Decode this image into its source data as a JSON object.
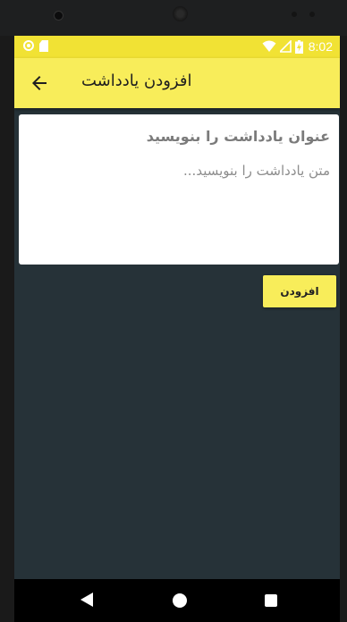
{
  "status_bar": {
    "time": "8:02",
    "icons": [
      "sync-circle-icon",
      "sd-card-icon",
      "wifi-icon",
      "signal-icon",
      "battery-charging-icon"
    ]
  },
  "app_bar": {
    "title": "افزودن یادداشت",
    "back_icon": "arrow-back-icon"
  },
  "form": {
    "title_placeholder": "عنوان یادداشت را بنویسید",
    "title_value": "",
    "body_placeholder": "متن یادداشت را بنویسید...",
    "body_value": ""
  },
  "actions": {
    "add_label": "افزودن"
  },
  "nav_bar": {
    "icons": [
      "nav-back-icon",
      "nav-home-icon",
      "nav-recent-icon"
    ]
  },
  "colors": {
    "accent": "#f8ed5a",
    "status_bar": "#f1e234",
    "background": "#263238",
    "card": "#ffffff"
  }
}
